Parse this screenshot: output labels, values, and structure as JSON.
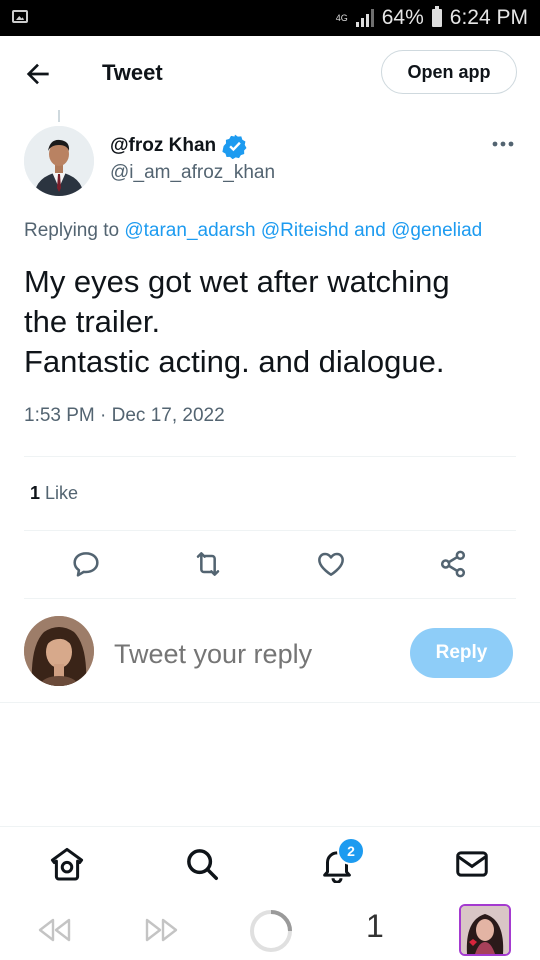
{
  "status_bar": {
    "network": "4G",
    "battery": "64%",
    "time": "6:24 PM"
  },
  "header": {
    "title": "Tweet",
    "open_app": "Open app"
  },
  "tweet": {
    "author_name": "@froz Khan",
    "author_handle": "@i_am_afroz_khan",
    "replying_prefix": "Replying to",
    "reply_to": [
      "@taran_adarsh",
      "@Riteishd",
      "@geneliad"
    ],
    "reply_and": "and",
    "text_lines": [
      "My eyes got wet after watching",
      "the trailer.",
      "Fantastic acting. and dialogue."
    ],
    "timestamp": "1:53 PM · Dec 17, 2022",
    "like_count": "1",
    "like_label": "Like"
  },
  "reply_composer": {
    "placeholder": "Tweet your reply",
    "button": "Reply"
  },
  "bottom_nav": {
    "notification_badge": "2",
    "items": [
      "home-icon",
      "search-icon",
      "notifications-icon",
      "messages-icon"
    ]
  },
  "browser": {
    "tab_count": "1"
  },
  "colors": {
    "accent": "#1d9bf0",
    "reply_button": "#8ecdf8",
    "secondary_text": "#536471"
  }
}
